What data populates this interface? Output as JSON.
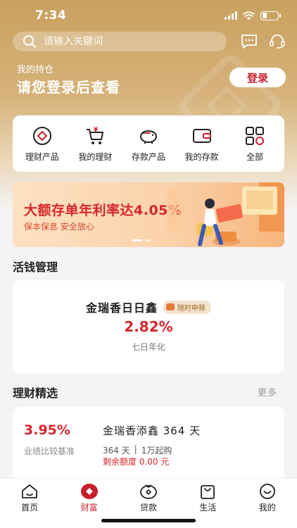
{
  "status_bar": {
    "time": "7:34"
  },
  "search": {
    "placeholder": "请输入关键词"
  },
  "header_icons": [
    "message-icon",
    "customer-service-icon"
  ],
  "holdings": {
    "label": "我的持仓",
    "title": "请您登录后查看",
    "login_label": "登录"
  },
  "quick_menu": [
    {
      "label": "理财产品",
      "icon": "wealth-product-icon"
    },
    {
      "label": "我的理财",
      "icon": "cart-yen-icon"
    },
    {
      "label": "存款产品",
      "icon": "piggy-bank-icon"
    },
    {
      "label": "我的存款",
      "icon": "wallet-icon"
    },
    {
      "label": "全部",
      "icon": "grid-icon"
    }
  ],
  "banner": {
    "title": "大额存单年利率达4.05%",
    "subtitle": "保本保息 安全放心"
  },
  "cash_section": {
    "title": "活钱管理",
    "product_name": "金瑞香日日鑫",
    "tag": "随时申赎",
    "rate": "2.82%",
    "rate_label": "七日年化"
  },
  "picks_section": {
    "title": "理财精选",
    "more": "更多",
    "product": {
      "rate": "3.95%",
      "rate_label": "业绩比较基准",
      "name": "金瑞香添鑫 364 天",
      "term": "364 天",
      "separator": "|",
      "min_amount": "1万起购",
      "remaining": "剩余额度 0.00 元"
    }
  },
  "tabbar": [
    {
      "label": "首页",
      "icon": "home-icon",
      "active": false
    },
    {
      "label": "财富",
      "icon": "wealth-icon",
      "active": true
    },
    {
      "label": "贷款",
      "icon": "loan-icon",
      "active": false
    },
    {
      "label": "生活",
      "icon": "shopping-bag-icon",
      "active": false
    },
    {
      "label": "我的",
      "icon": "profile-icon",
      "active": false
    }
  ],
  "colors": {
    "brand_red": "#c81e2c",
    "gold": "#c9a15f",
    "rate_red": "#d8262c"
  }
}
